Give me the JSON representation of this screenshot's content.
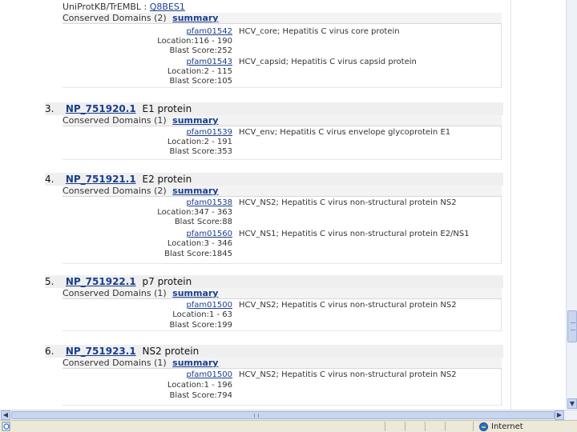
{
  "top_block": {
    "xref_label": "UniProtKB/TrEMBL :",
    "xref_id": "Q8BES1",
    "cd_label": "Conserved Domains (2)",
    "summary": "summary",
    "domains": [
      {
        "pfam": "pfam01542",
        "desc": "HCV_core; Hepatitis C virus core protein",
        "location": "Location:116 - 190",
        "blast": "Blast Score:252"
      },
      {
        "pfam": "pfam01543",
        "desc": "HCV_capsid; Hepatitis C virus capsid protein",
        "location": "Location:2 - 115",
        "blast": "Blast Score:105"
      }
    ]
  },
  "entries": [
    {
      "num": "3.",
      "accession": "NP_751920.1",
      "protein": "E1 protein",
      "cd_label": "Conserved Domains (1)",
      "summary": "summary",
      "domains": [
        {
          "pfam": "pfam01539",
          "desc": "HCV_env; Hepatitis C virus envelope glycoprotein E1",
          "location": "Location:2 - 191",
          "blast": "Blast Score:353"
        }
      ]
    },
    {
      "num": "4.",
      "accession": "NP_751921.1",
      "protein": "E2 protein",
      "cd_label": "Conserved Domains (2)",
      "summary": "summary",
      "domains": [
        {
          "pfam": "pfam01538",
          "desc": "HCV_NS2; Hepatitis C virus non-structural protein NS2",
          "location": "Location:347 - 363",
          "blast": "Blast Score:88"
        },
        {
          "pfam": "pfam01560",
          "desc": "HCV_NS1; Hepatitis C virus non-structural protein E2/NS1",
          "location": "Location:3 - 346",
          "blast": "Blast Score:1845"
        }
      ]
    },
    {
      "num": "5.",
      "accession": "NP_751922.1",
      "protein": "p7 protein",
      "cd_label": "Conserved Domains (1)",
      "summary": "summary",
      "domains": [
        {
          "pfam": "pfam01500",
          "desc": "HCV_NS2; Hepatitis C virus non-structural protein NS2",
          "location": "Location:1 - 63",
          "blast": "Blast Score:199"
        }
      ]
    },
    {
      "num": "6.",
      "accession": "NP_751923.1",
      "protein": "NS2 protein",
      "cd_label": "Conserved Domains (1)",
      "summary": "summary",
      "domains": [
        {
          "pfam": "pfam01500",
          "desc": "HCV_NS2; Hepatitis C virus non-structural protein NS2",
          "location": "Location:1 - 196",
          "blast": "Blast Score:794"
        }
      ]
    }
  ],
  "status_bar": {
    "zone_text": "Internet",
    "zone_icon": "globe-icon",
    "page_icon": "ie-page-icon"
  },
  "colors": {
    "link": "#1a3e8c",
    "row_bg": "#efefef",
    "status_bg": "#ece9d8",
    "scroll": "#c9d6ee"
  }
}
